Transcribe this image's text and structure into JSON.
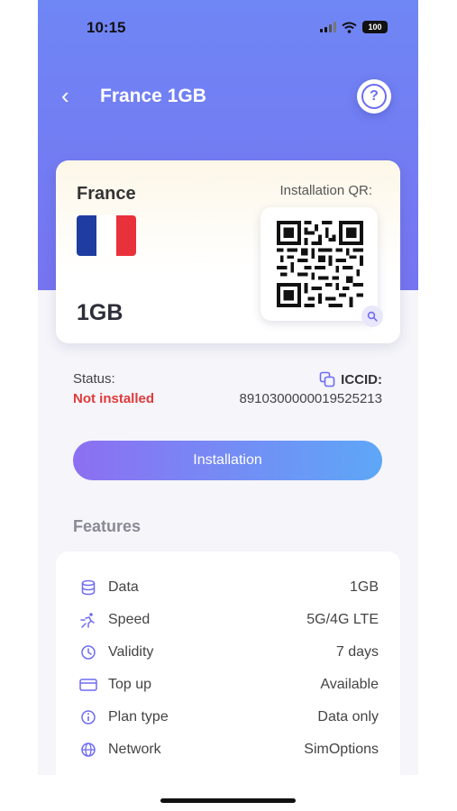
{
  "status_bar": {
    "time": "10:15",
    "battery": "100"
  },
  "nav": {
    "back_symbol": "‹",
    "title": "France 1GB",
    "help_symbol": "?"
  },
  "plan": {
    "country": "France",
    "data_amount": "1GB",
    "qr_label": "Installation QR:",
    "flag_colors": [
      "#1f3da0",
      "#ffffff",
      "#e8313a"
    ]
  },
  "status": {
    "label": "Status:",
    "value": "Not installed"
  },
  "iccid": {
    "label": "ICCID:",
    "value": "8910300000019525213"
  },
  "install_button": {
    "label": "Installation"
  },
  "features": {
    "title": "Features",
    "items": [
      {
        "icon": "database-icon",
        "label": "Data",
        "value": "1GB"
      },
      {
        "icon": "speed-icon",
        "label": "Speed",
        "value": "5G/4G LTE"
      },
      {
        "icon": "clock-icon",
        "label": "Validity",
        "value": "7 days"
      },
      {
        "icon": "card-icon",
        "label": "Top up",
        "value": "Available"
      },
      {
        "icon": "info-icon",
        "label": "Plan type",
        "value": "Data only"
      },
      {
        "icon": "globe-icon",
        "label": "Network",
        "value": "SimOptions"
      }
    ]
  },
  "colors": {
    "accent": "#6e6cf0",
    "header": "#7480f2",
    "error": "#e03a3a"
  }
}
